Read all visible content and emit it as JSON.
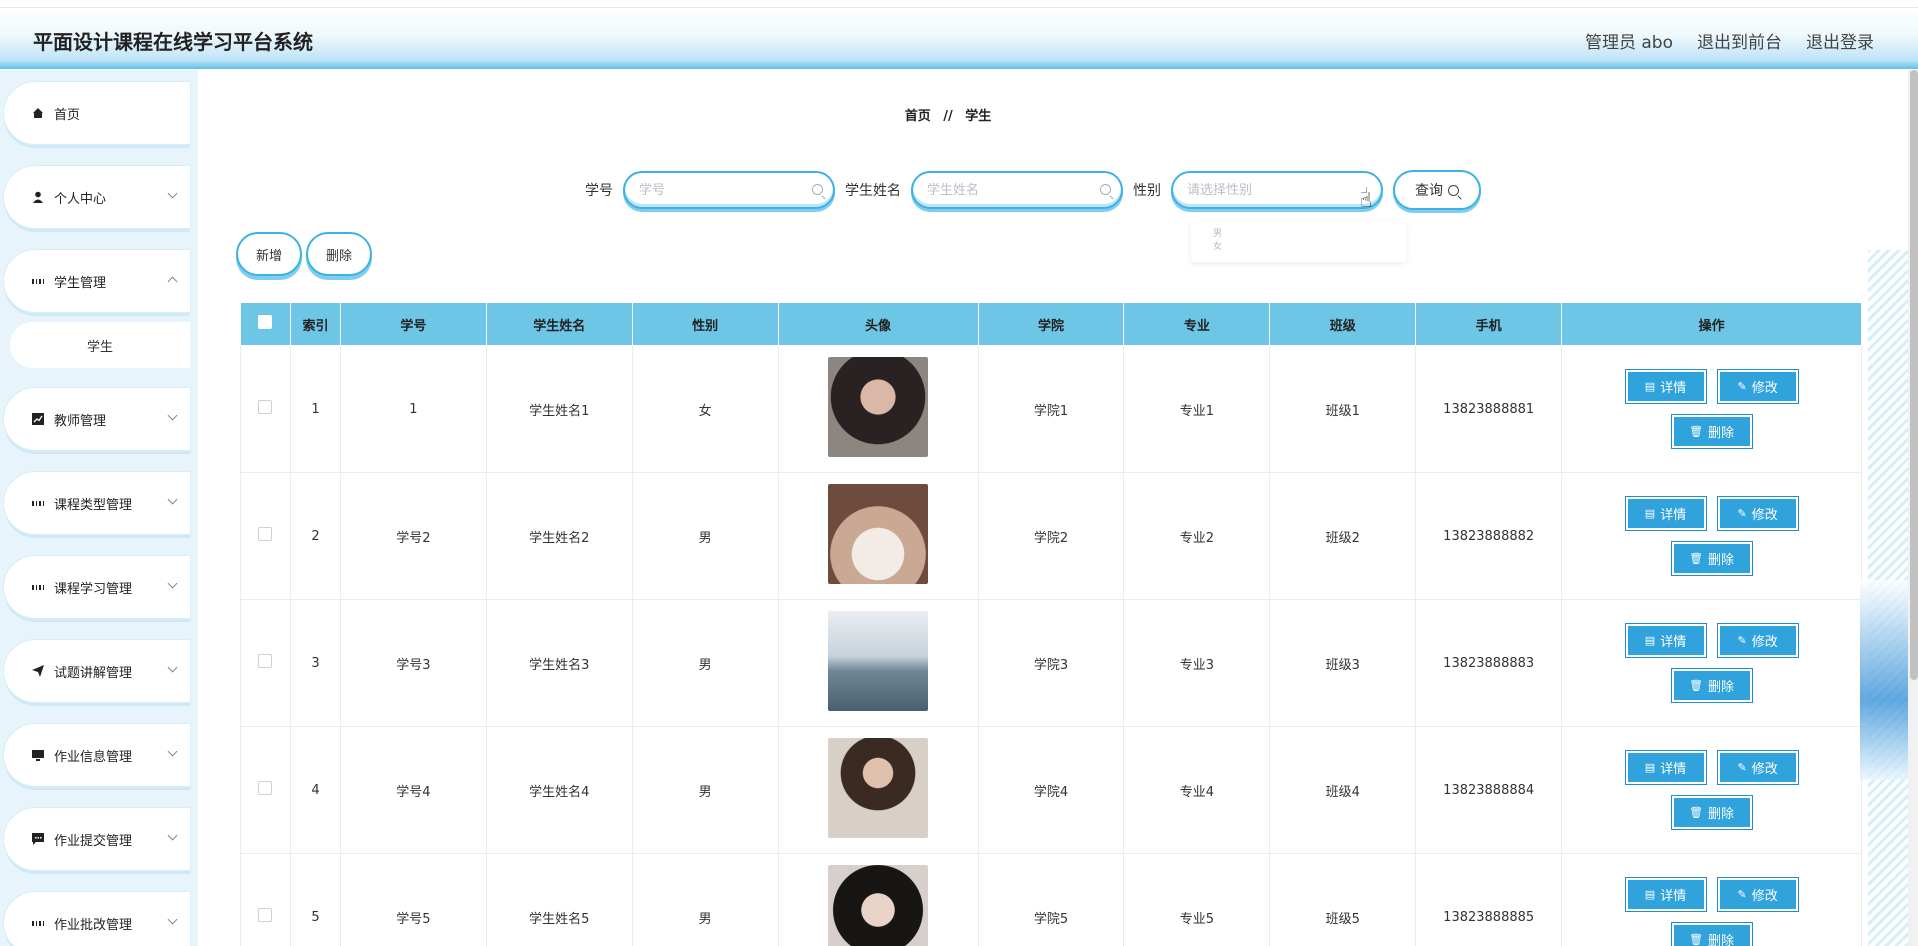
{
  "header": {
    "title": "平面设计课程在线学习平台系统",
    "admin": "管理员 abo",
    "to_front": "退出到前台",
    "logout": "退出登录"
  },
  "sidebar": {
    "items": [
      {
        "label": "首页",
        "icon": "home-icon"
      },
      {
        "label": "个人中心",
        "icon": "user-icon"
      },
      {
        "label": "学生管理",
        "icon": "grid-icon"
      },
      {
        "label": "教师管理",
        "icon": "chart-icon"
      },
      {
        "label": "课程类型管理",
        "icon": "grid-icon"
      },
      {
        "label": "课程学习管理",
        "icon": "grid-icon"
      },
      {
        "label": "试题讲解管理",
        "icon": "send-icon"
      },
      {
        "label": "作业信息管理",
        "icon": "monitor-icon"
      },
      {
        "label": "作业提交管理",
        "icon": "chat-icon"
      },
      {
        "label": "作业批改管理",
        "icon": "grid-icon"
      }
    ],
    "sub_item": "学生"
  },
  "breadcrumb": {
    "home": "首页",
    "sep": "//",
    "current": "学生"
  },
  "search": {
    "id_label": "学号",
    "id_placeholder": "学号",
    "name_label": "学生姓名",
    "name_placeholder": "学生姓名",
    "gender_label": "性别",
    "gender_placeholder": "请选择性别",
    "query_label": "查询"
  },
  "dropdown": {
    "options": [
      "男",
      "女"
    ]
  },
  "actions": {
    "add": "新增",
    "delete": "删除"
  },
  "table": {
    "headers": [
      "索引",
      "学号",
      "学生姓名",
      "性别",
      "头像",
      "学院",
      "专业",
      "班级",
      "手机",
      "操作"
    ],
    "rows": [
      {
        "index": "1",
        "id": "1",
        "name": "学生姓名1",
        "gender": "女",
        "college": "学院1",
        "major": "专业1",
        "class": "班级1",
        "phone": "13823888881"
      },
      {
        "index": "2",
        "id": "学号2",
        "name": "学生姓名2",
        "gender": "男",
        "college": "学院2",
        "major": "专业2",
        "class": "班级2",
        "phone": "13823888882"
      },
      {
        "index": "3",
        "id": "学号3",
        "name": "学生姓名3",
        "gender": "男",
        "college": "学院3",
        "major": "专业3",
        "class": "班级3",
        "phone": "13823888883"
      },
      {
        "index": "4",
        "id": "学号4",
        "name": "学生姓名4",
        "gender": "男",
        "college": "学院4",
        "major": "专业4",
        "class": "班级4",
        "phone": "13823888884"
      },
      {
        "index": "5",
        "id": "学号5",
        "name": "学生姓名5",
        "gender": "男",
        "college": "学院5",
        "major": "专业5",
        "class": "班级5",
        "phone": "13823888885"
      }
    ],
    "op_detail": "详情",
    "op_edit": "修改",
    "op_delete": "删除"
  },
  "colors": {
    "accent": "#30a3dd",
    "header_row": "#6dc6e5",
    "sidebar_bg": "#e7f4fb"
  }
}
